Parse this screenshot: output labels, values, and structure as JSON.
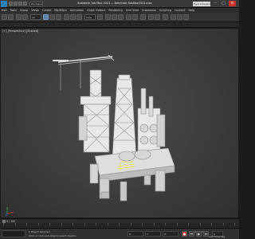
{
  "app": {
    "title": "Autodesk 3ds Max 2015 — Bohrinsel 3dsMax2015.max",
    "workspace": "Workspace: Default",
    "search_placeholder": "Type a keyword"
  },
  "menu": [
    "Edit",
    "Tools",
    "Group",
    "Views",
    "Create",
    "Modifiers",
    "Animation",
    "Graph Editors",
    "Rendering",
    "Civil View",
    "Customize",
    "Scripting",
    "Content",
    "Help"
  ],
  "toolbar": {
    "selection_filter": "All",
    "reference_coord": "View"
  },
  "viewport": {
    "label": "[+] [Perspective] [Shaded]",
    "selection_label": "Bohrinsel"
  },
  "timeline": {
    "frame_counter": "0 / 100"
  },
  "status": {
    "hint": "1 Object Selected",
    "prompt": "Click or click-and-drag to select objects",
    "x": "X:",
    "y": "Y:",
    "z": "Z:",
    "grid": "Grid = 10,0cm",
    "add_time_tag": "Add Time Tag",
    "frame_value": "0"
  },
  "colors": {
    "accent": "#c9342f",
    "model": "#e6e6e6",
    "selection": "#f2e600"
  }
}
